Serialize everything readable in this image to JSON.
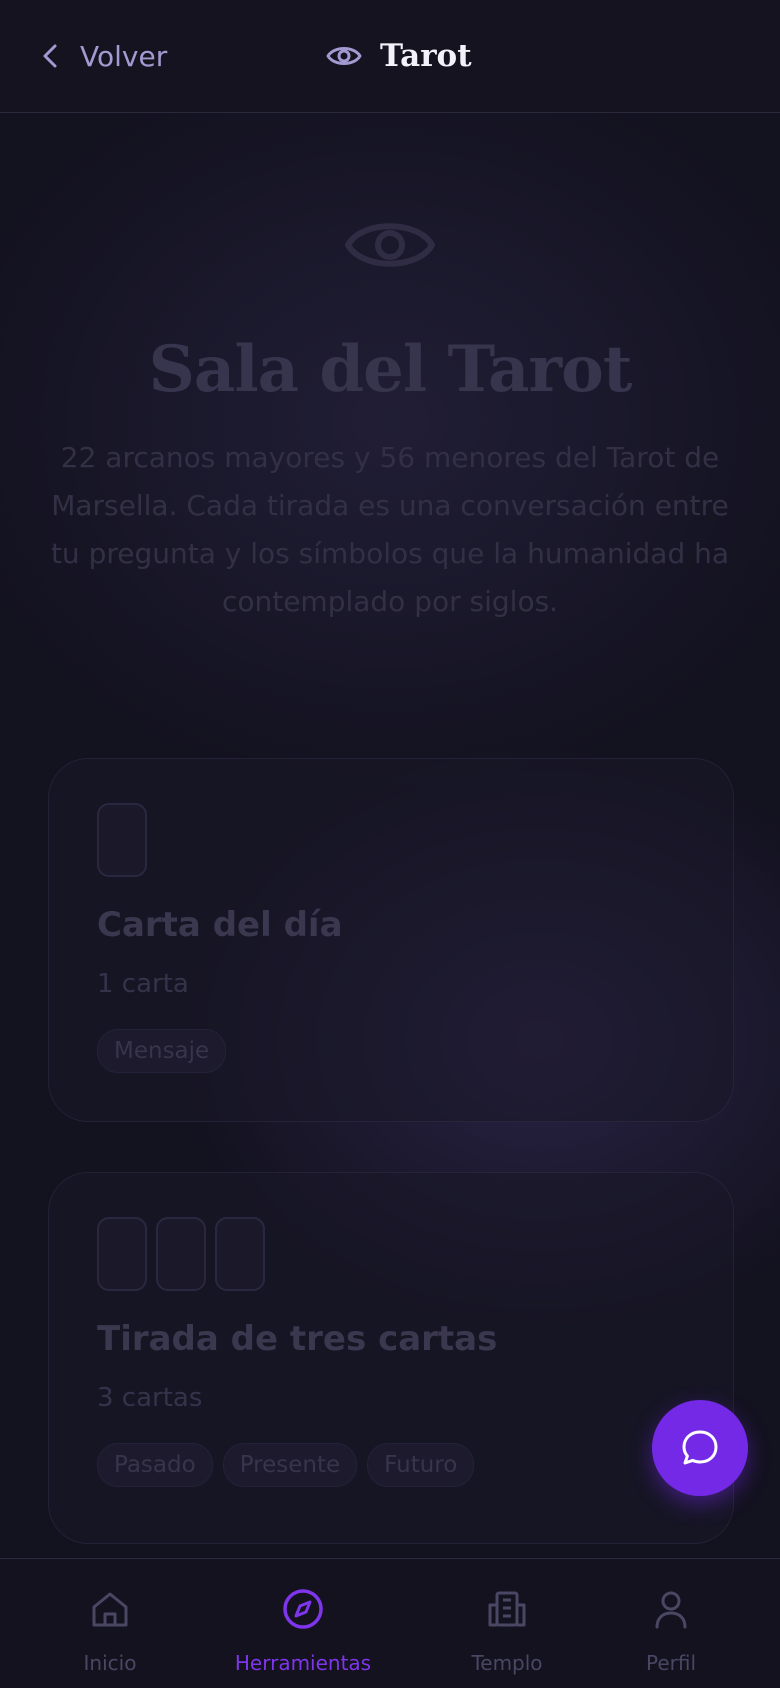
{
  "header": {
    "back_label": "Volver",
    "title": "Tarot",
    "title_icon": "eye-icon",
    "back_icon": "chevron-left-icon"
  },
  "hero": {
    "icon": "eye-icon",
    "title": "Sala del Tarot",
    "description": "22 arcanos mayores y 56 menores del Tarot de Marsella. Cada tirada es una conversación entre tu pregunta y los símbolos que la humanidad ha contemplado por siglos."
  },
  "spreads": [
    {
      "title": "Carta del día",
      "subtitle": "1 carta",
      "card_count": 1,
      "tags": [
        "Mensaje"
      ]
    },
    {
      "title": "Tirada de tres cartas",
      "subtitle": "3 cartas",
      "card_count": 3,
      "tags": [
        "Pasado",
        "Presente",
        "Futuro"
      ]
    }
  ],
  "fab": {
    "icon": "chat-bubble-icon"
  },
  "nav": {
    "items": [
      {
        "label": "Inicio",
        "icon": "home-icon",
        "active": false
      },
      {
        "label": "Herramientas",
        "icon": "compass-icon",
        "active": true
      },
      {
        "label": "Templo",
        "icon": "building-icon",
        "active": false
      },
      {
        "label": "Perfil",
        "icon": "user-icon",
        "active": false
      }
    ]
  },
  "colors": {
    "accent": "#7429e6",
    "background": "#13121f",
    "back_link": "#a29ad0"
  }
}
